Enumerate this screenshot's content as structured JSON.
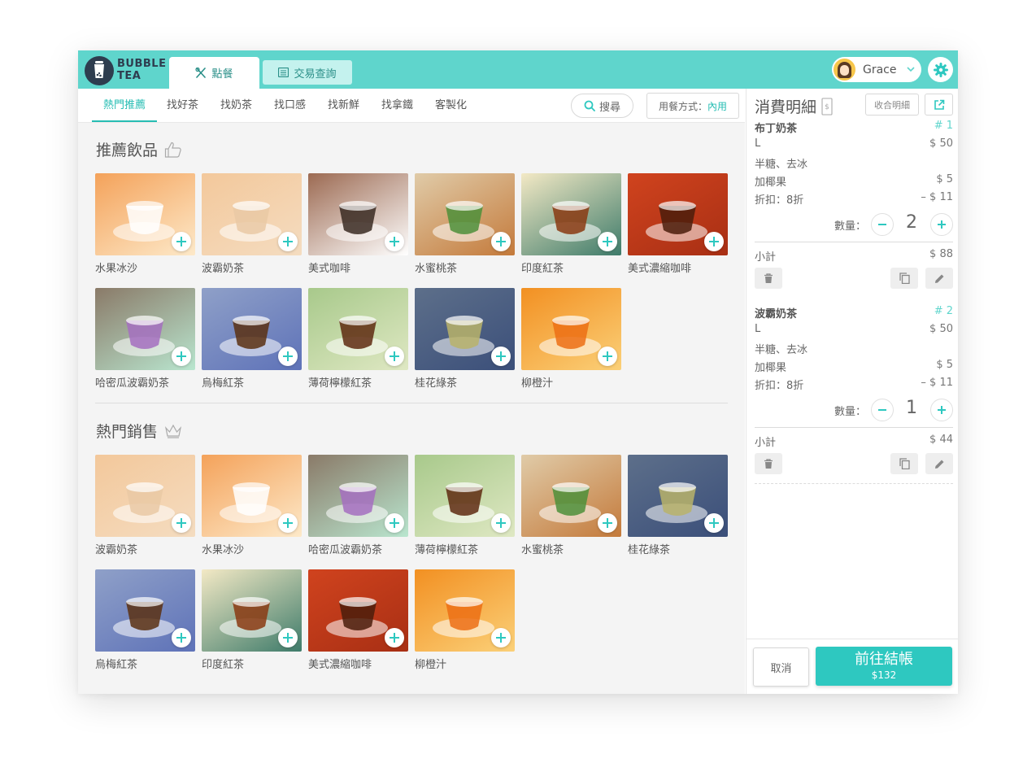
{
  "brand": {
    "line1": "BUBBLE",
    "line2": "TEA"
  },
  "tabs": [
    {
      "label": "點餐",
      "icon": "utensils-icon"
    },
    {
      "label": "交易查詢",
      "icon": "list-icon"
    }
  ],
  "user": {
    "name": "Grace"
  },
  "nav": {
    "items": [
      "熱門推薦",
      "找好茶",
      "找奶茶",
      "找口感",
      "找新鮮",
      "找拿鐵",
      "客製化"
    ],
    "search_label": "搜尋",
    "dine_label": "用餐方式：",
    "dine_value": "內用"
  },
  "sections": [
    {
      "title": "推薦飲品",
      "icon": "thumbs-up-icon",
      "items": [
        "水果冰沙",
        "波霸奶茶",
        "美式咖啡",
        "水蜜桃茶",
        "印度紅茶",
        "美式濃縮咖啡",
        "哈密瓜波霸奶茶",
        "烏梅紅茶",
        "薄荷檸檬紅茶",
        "桂花綠茶",
        "柳橙汁"
      ]
    },
    {
      "title": "熱門銷售",
      "icon": "crown-icon",
      "items": [
        "波霸奶茶",
        "水果冰沙",
        "哈密瓜波霸奶茶",
        "薄荷檸檬紅茶",
        "水蜜桃茶",
        "桂花綠茶",
        "烏梅紅茶",
        "印度紅茶",
        "美式濃縮咖啡",
        "柳橙汁"
      ]
    }
  ],
  "panel": {
    "title": "消費明細",
    "collapse_label": "收合明細",
    "qty_label": "數量：",
    "subtotal_label": "小計",
    "orders": [
      {
        "name": "布丁奶茶",
        "no": "# 1",
        "size": "L",
        "size_price": "$ 50",
        "options": "半糖、去冰",
        "addon": "加椰果",
        "addon_price": "$ 5",
        "discount": "折扣：8折",
        "discount_price": "– $ 11",
        "qty": "2",
        "subtotal": "$ 88"
      },
      {
        "name": "波霸奶茶",
        "no": "# 2",
        "size": "L",
        "size_price": "$ 50",
        "options": "半糖、去冰",
        "addon": "加椰果",
        "addon_price": "$ 5",
        "discount": "折扣：8折",
        "discount_price": "– $ 11",
        "qty": "1",
        "subtotal": "$ 44"
      }
    ],
    "cancel_label": "取消",
    "checkout_label": "前往結帳",
    "checkout_total": "$132"
  },
  "colors": {
    "accent": "#5fd5cc",
    "button": "#2ec8c0",
    "brand_dark": "#2e3d4f"
  }
}
